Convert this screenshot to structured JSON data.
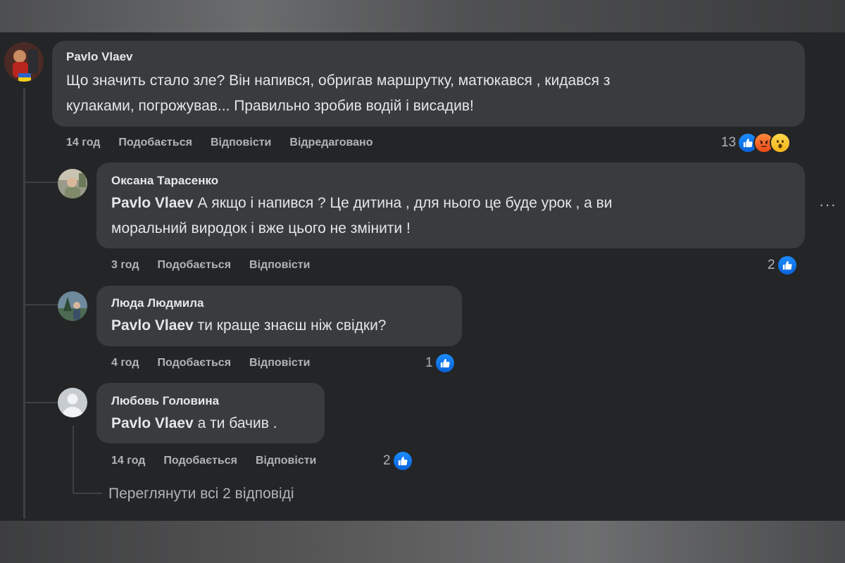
{
  "comments": [
    {
      "author": "Pavlo Vlaev",
      "text_line1": "Що значить стало зле? Він напився, обригав маршрутку, матюкався , кидався з",
      "text_line2": "кулаками, погрожував... Правильно зробив водій і висадив!",
      "time": "14 год",
      "like": "Подобається",
      "reply": "Відповісти",
      "edited": "Відредаговано",
      "reaction_count": "13",
      "reactions": [
        "like-icon",
        "angry-icon",
        "wow-icon"
      ]
    },
    {
      "author": "Оксана Тарасенко",
      "mention": "Pavlo Vlaev",
      "text_line1": " А якщо і напився ? Це дитина , для нього це буде урок , а ви",
      "text_line2": "моральний виродок і вже цього не змінити !",
      "time": "3 год",
      "like": "Подобається",
      "reply": "Відповісти",
      "reaction_count": "2",
      "more": "···"
    },
    {
      "author": "Люда Людмила",
      "mention": "Pavlo Vlaev",
      "text": " ти краще знаєш ніж свідки?",
      "time": "4 год",
      "like": "Подобається",
      "reply": "Відповісти",
      "reaction_count": "1"
    },
    {
      "author": "Любовь Головина",
      "mention": "Pavlo Vlaev",
      "text": " а ти бачив .",
      "time": "14 год",
      "like": "Подобається",
      "reply": "Відповісти",
      "reaction_count": "2"
    }
  ],
  "view_replies": "Переглянути всі 2 відповіді",
  "colors": {
    "background": "#242526",
    "bubble": "#3a3b3c",
    "text": "#e4e6eb",
    "secondary_text": "#b0b3b8",
    "like_blue": "#1877f2"
  }
}
